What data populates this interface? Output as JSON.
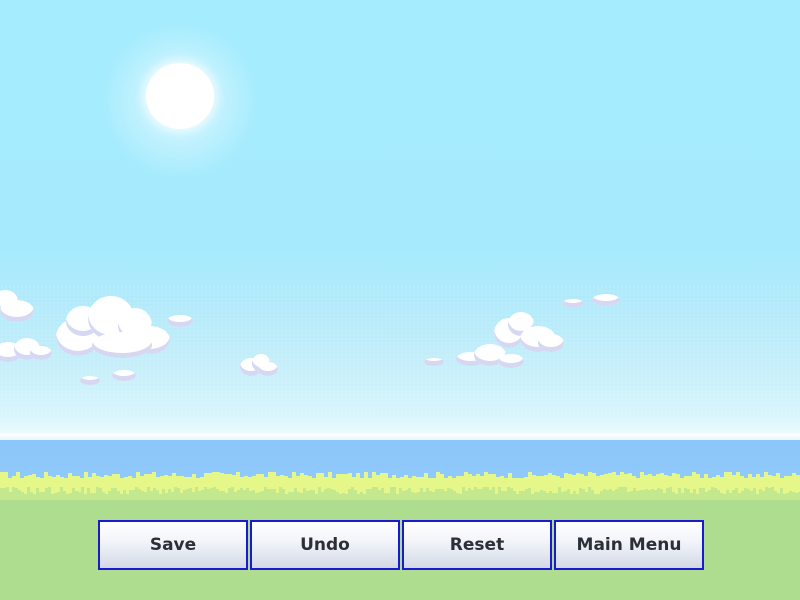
{
  "scene": {
    "sky_color": "#a4ecfe",
    "sea_color": "#8cc6fb",
    "grass_highlight_color": "#e6f78a",
    "ground_color": "#afdd8f",
    "sun_color": "#ffffff"
  },
  "menu": {
    "border_color": "#1a1ad0",
    "buttons": [
      {
        "label": "Save",
        "icon": "none"
      },
      {
        "label": "Undo",
        "icon": "none"
      },
      {
        "label": "Reset",
        "icon": "none"
      },
      {
        "label": "Main Menu",
        "icon": "none"
      }
    ]
  }
}
